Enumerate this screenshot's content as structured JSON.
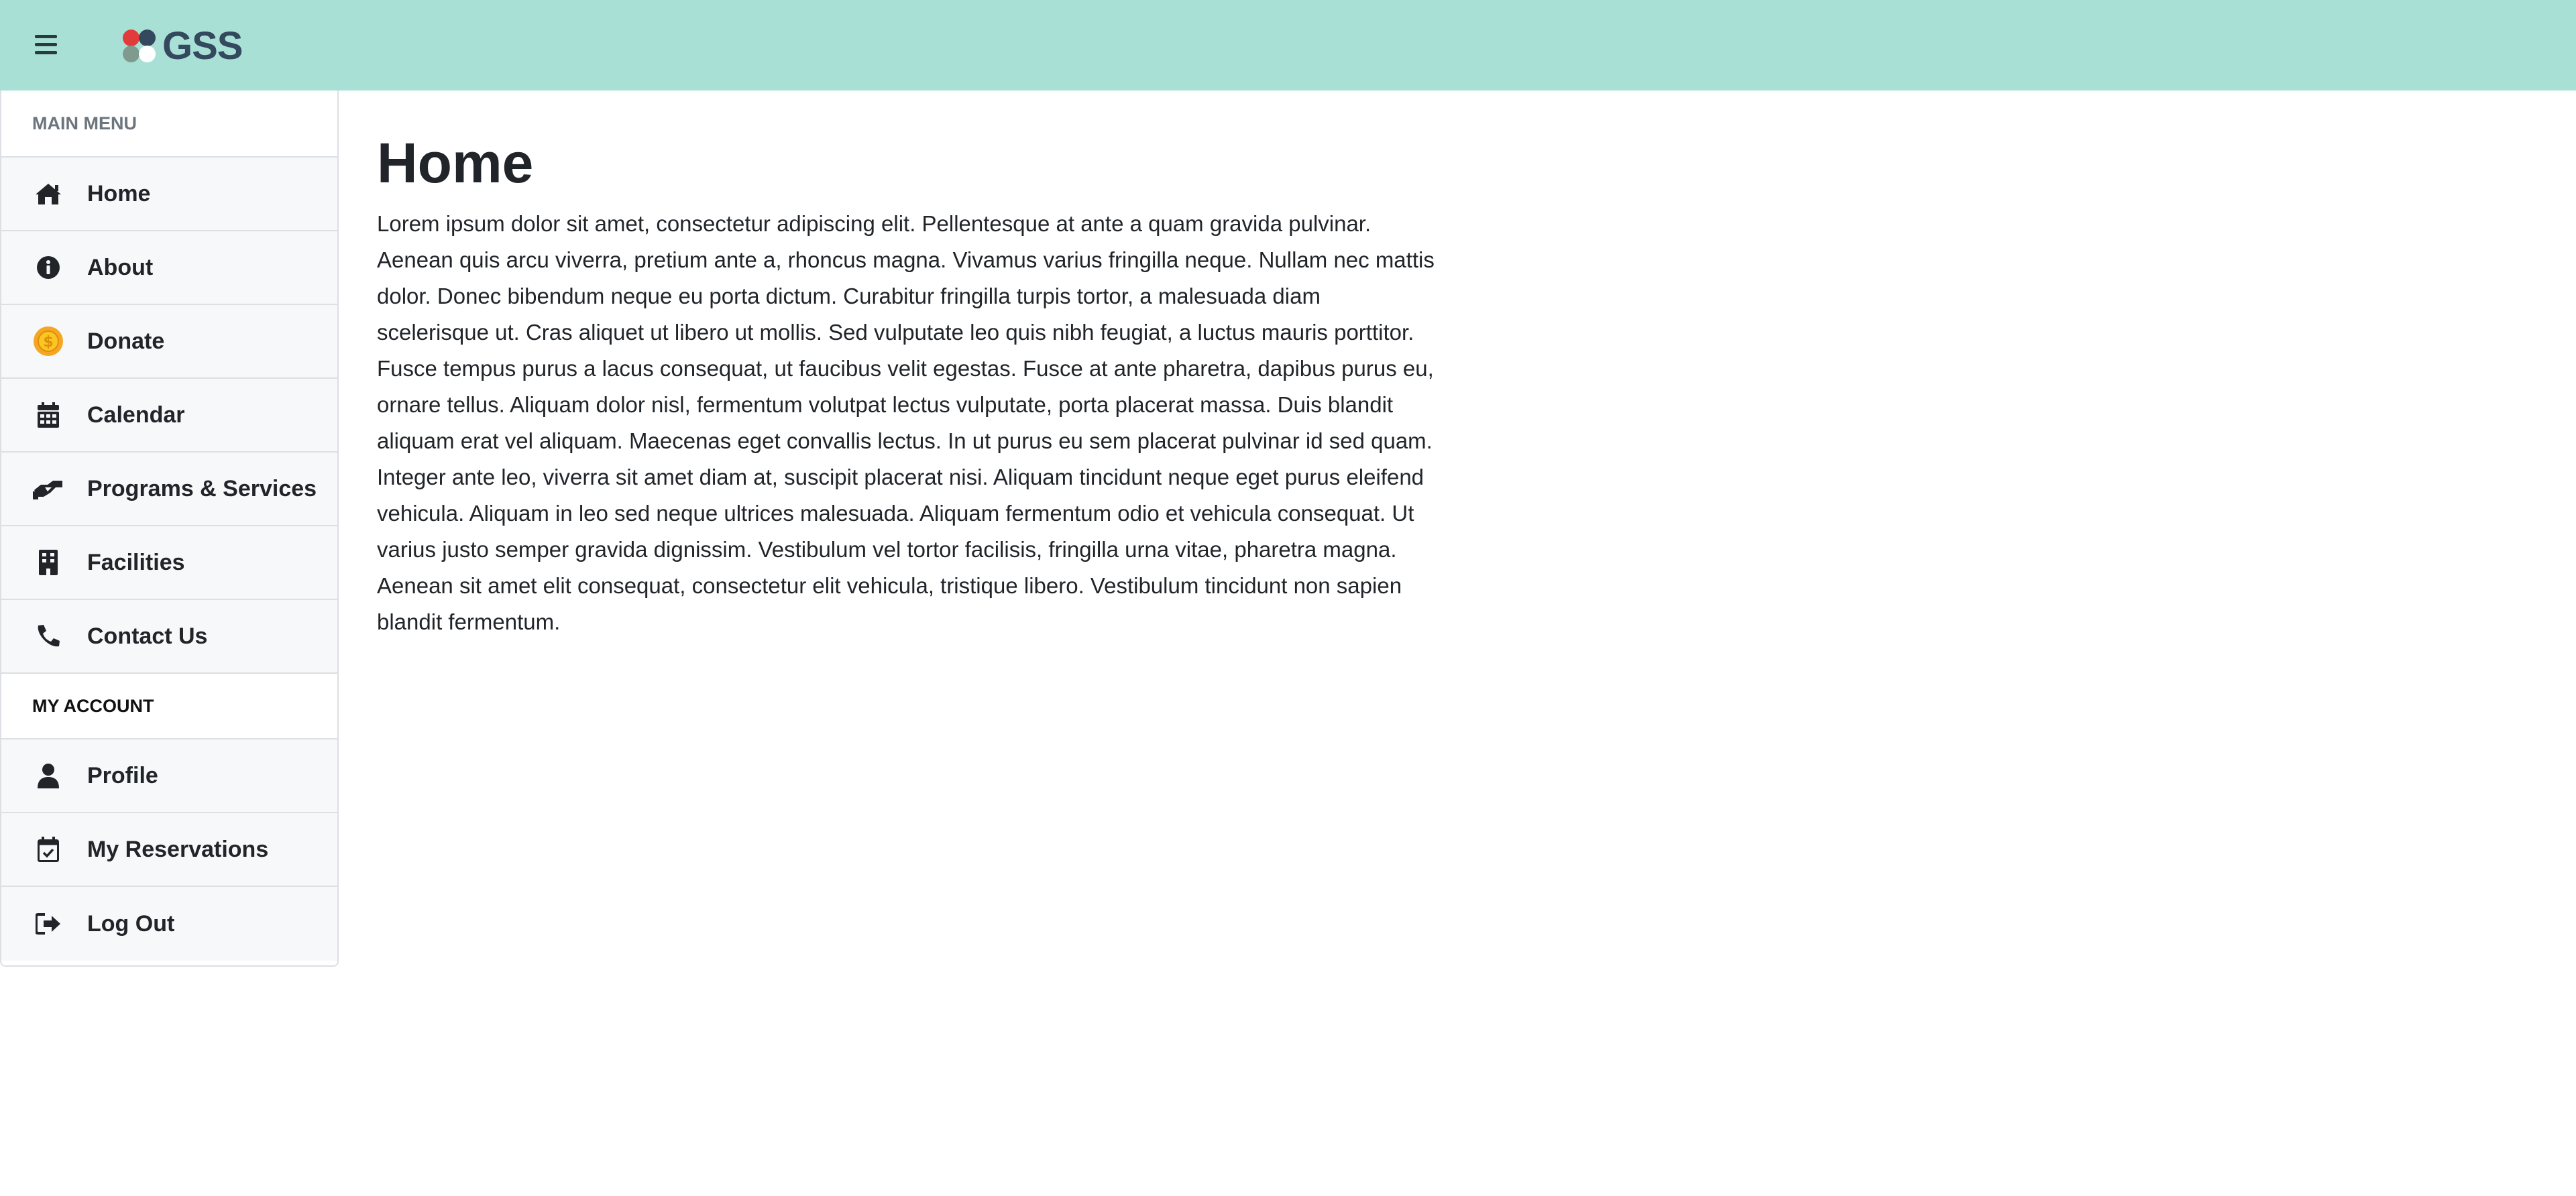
{
  "header": {
    "menu_icon": "hamburger-icon",
    "logo_text": "GSS",
    "background": "#a8e0d6"
  },
  "sidebar": {
    "main_menu_title": "MAIN MENU",
    "main_items": [
      {
        "label": "Home",
        "icon": "home-icon"
      },
      {
        "label": "About",
        "icon": "info-circle-icon"
      },
      {
        "label": "Donate",
        "icon": "coin-icon"
      },
      {
        "label": "Calendar",
        "icon": "calendar-icon"
      },
      {
        "label": "Programs & Services",
        "icon": "handshake-icon"
      },
      {
        "label": "Facilities",
        "icon": "building-icon"
      },
      {
        "label": "Contact Us",
        "icon": "phone-icon"
      }
    ],
    "account_title": "MY ACCOUNT",
    "account_items": [
      {
        "label": "Profile",
        "icon": "user-icon"
      },
      {
        "label": "My Reservations",
        "icon": "calendar-check-icon"
      },
      {
        "label": "Log Out",
        "icon": "sign-out-icon"
      }
    ]
  },
  "main": {
    "title": "Home",
    "body": "Lorem ipsum dolor sit amet, consectetur adipiscing elit. Pellentesque at ante a quam gravida pulvinar. Aenean quis arcu viverra, pretium ante a, rhoncus magna. Vivamus varius fringilla neque. Nullam nec mattis dolor. Donec bibendum neque eu porta dictum. Curabitur fringilla turpis tortor, a malesuada diam scelerisque ut. Cras aliquet ut libero ut mollis. Sed vulputate leo quis nibh feugiat, a luctus mauris porttitor. Fusce tempus purus a lacus consequat, ut faucibus velit egestas. Fusce at ante pharetra, dapibus purus eu, ornare tellus. Aliquam dolor nisl, fermentum volutpat lectus vulputate, porta placerat massa. Duis blandit aliquam erat vel aliquam. Maecenas eget convallis lectus. In ut purus eu sem placerat pulvinar id sed quam. Integer ante leo, viverra sit amet diam at, suscipit placerat nisi. Aliquam tincidunt neque eget purus eleifend vehicula. Aliquam in leo sed neque ultrices malesuada. Aliquam fermentum odio et vehicula consequat. Ut varius justo semper gravida dignissim. Vestibulum vel tortor facilisis, fringilla urna vitae, pharetra magna. Aenean sit amet elit consequat, consectetur elit vehicula, tristique libero. Vestibulum tincidunt non sapien blandit fermentum."
  }
}
